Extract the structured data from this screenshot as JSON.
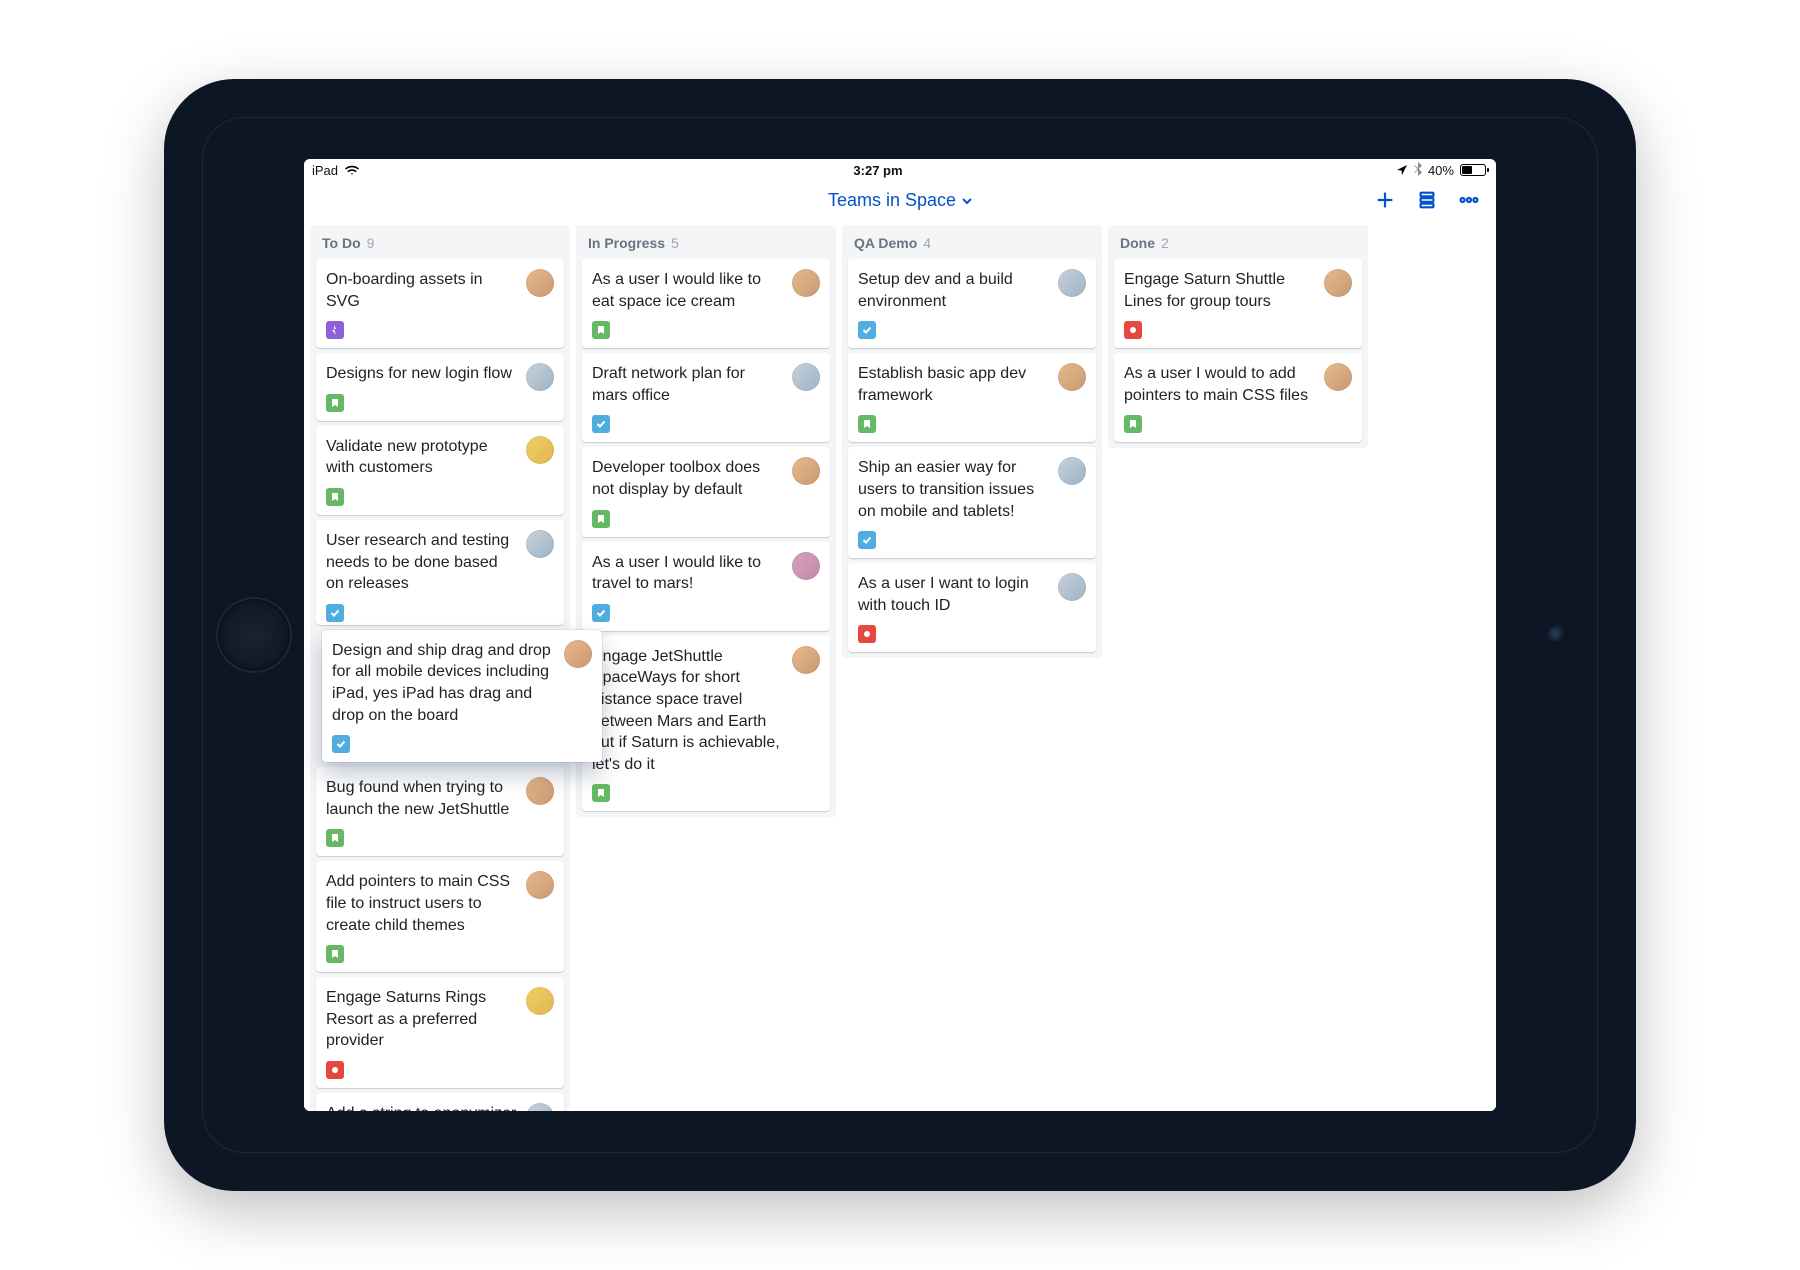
{
  "statusbar": {
    "carrier": "iPad",
    "time": "3:27 pm",
    "battery_pct": "40%"
  },
  "header": {
    "board_name": "Teams in Space"
  },
  "avatarPalette": {
    "a": "linear-gradient(135deg,#e8b98e,#c99871)",
    "b": "linear-gradient(135deg,#c7d2db,#9db3c5)",
    "c": "linear-gradient(135deg,#efce6a,#e2b64f)",
    "d": "linear-gradient(135deg,#d8a0bf,#c388a9)",
    "e": "linear-gradient(135deg,#cfe8d7,#a8d1bb)",
    "f": "linear-gradient(135deg,#8fc1d9,#6ba6c2)"
  },
  "columns": [
    {
      "title": "To Do",
      "count": "9",
      "cards": [
        {
          "text": "On-boarding assets in SVG",
          "type": "epic",
          "avatar": "a"
        },
        {
          "text": "Designs for new login flow",
          "type": "story",
          "avatar": "b"
        },
        {
          "text": "Validate new prototype with customers",
          "type": "story",
          "avatar": "c"
        },
        {
          "text": "User research and testing needs to be done based on releases",
          "type": "task",
          "avatar": "b",
          "clip": true
        },
        {
          "text": "Design and ship drag and drop for all mobile devices including iPad, yes iPad has drag and drop on the board",
          "type": "task",
          "avatar": "a",
          "elevated": true
        },
        {
          "text": "Bug found when trying to launch the new  JetShuttle",
          "type": "story",
          "avatar": "a"
        },
        {
          "text": "Add pointers to main CSS file to instruct users to create child themes",
          "type": "story",
          "avatar": "a"
        },
        {
          "text": "Engage Saturns Rings Resort as a preferred provider",
          "type": "bug",
          "avatar": "c"
        },
        {
          "text": "Add a string to anonymizer main textutils",
          "type": "story",
          "avatar": "b"
        }
      ]
    },
    {
      "title": "In Progress",
      "count": "5",
      "cards": [
        {
          "text": "As a user I would like to eat space ice cream",
          "type": "story",
          "avatar": "a"
        },
        {
          "text": "Draft network plan for mars office",
          "type": "task",
          "avatar": "b"
        },
        {
          "text": "Developer toolbox does not display by default",
          "type": "story",
          "avatar": "a"
        },
        {
          "text": "As a user I would like to travel to mars!",
          "type": "task",
          "avatar": "d"
        },
        {
          "text": "Engage JetShuttle SpaceWays for short distance space travel between Mars and Earth but if Saturn is achievable, let's do it",
          "type": "story",
          "avatar": "a"
        }
      ]
    },
    {
      "title": "QA Demo",
      "count": "4",
      "cards": [
        {
          "text": "Setup dev and a build environment",
          "type": "task",
          "avatar": "b"
        },
        {
          "text": "Establish basic app dev framework",
          "type": "story",
          "avatar": "a"
        },
        {
          "text": "Ship an easier way for users to transition issues on mobile and tablets!",
          "type": "task",
          "avatar": "b"
        },
        {
          "text": "As a user I want to login with touch ID",
          "type": "bug",
          "avatar": "b"
        }
      ]
    },
    {
      "title": "Done",
      "count": "2",
      "cards": [
        {
          "text": "Engage Saturn Shuttle Lines for group tours",
          "type": "bug",
          "avatar": "a"
        },
        {
          "text": "As a user I would to add pointers to main CSS files",
          "type": "story",
          "avatar": "a"
        }
      ]
    }
  ]
}
